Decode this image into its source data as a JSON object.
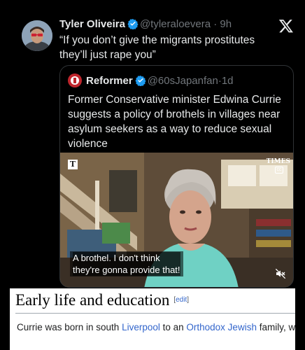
{
  "tweet": {
    "author_name": "Tyler Oliveira",
    "author_handle": "@tyleraloevera",
    "time": "9h",
    "text_line1": "“If you don’t give the migrants prostitutes",
    "text_line2": "they’ll just rape you”"
  },
  "quote": {
    "author_name": "Reformer",
    "author_handle": "@60sJapanfan",
    "time": "1d",
    "text_line1": "Former Conservative minister Edwina Currie",
    "text_line2": "suggests a policy of brothels in villages near",
    "text_line3": "asylum seekers as a way to reduce sexual",
    "text_line4": "violence",
    "video": {
      "watermark_left": "T",
      "watermark_right": "TIMES",
      "cc_label": "cc",
      "subtitle_line1": "A brothel. I don't think",
      "subtitle_line2": "they're gonna provide that!"
    }
  },
  "wiki": {
    "heading": "Early life and education",
    "edit_bracket_open": "[",
    "edit_label": "edit",
    "edit_bracket_close": "]",
    "text_before": "Currie was born in south ",
    "link1": "Liverpool",
    "text_middle": " to an ",
    "link2": "Orthodox Jewish",
    "text_after": " family, w"
  },
  "colors": {
    "background": "#000000",
    "primary_text": "#e7e9ea",
    "secondary_text": "#71767b",
    "verified_blue": "#1d9bf0",
    "wiki_link": "#3366cc"
  },
  "icons": [
    "verified-badge-icon",
    "x-logo-icon",
    "cc-icon",
    "mute-icon"
  ]
}
